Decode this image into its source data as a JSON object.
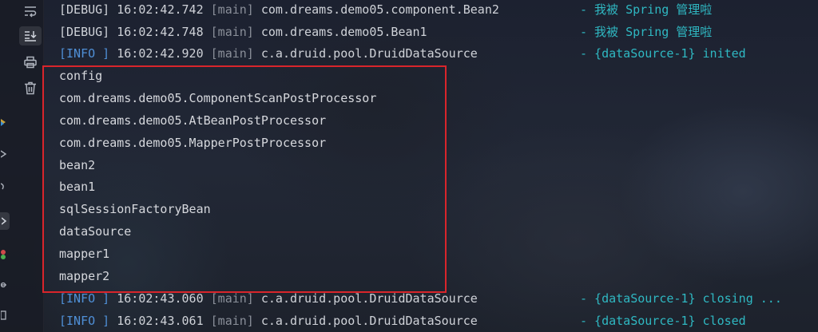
{
  "toolbar": {
    "icons": [
      "soft-wrap-icon",
      "scroll-to-end-icon",
      "print-icon",
      "trash-icon"
    ]
  },
  "log_top": [
    {
      "level": "[DEBUG]",
      "time": "16:02:42.742",
      "thread": "[main]",
      "logger": "com.dreams.demo05.component.Bean2",
      "message": "- 我被 Spring 管理啦"
    },
    {
      "level": "[DEBUG]",
      "time": "16:02:42.748",
      "thread": "[main]",
      "logger": "com.dreams.demo05.Bean1",
      "message": "- 我被 Spring 管理啦"
    },
    {
      "level": "[INFO ]",
      "time": "16:02:42.920",
      "thread": "[main]",
      "logger": "c.a.druid.pool.DruidDataSource",
      "message": "- {dataSource-1} inited"
    }
  ],
  "output_lines": [
    "config",
    "com.dreams.demo05.ComponentScanPostProcessor",
    "com.dreams.demo05.AtBeanPostProcessor",
    "com.dreams.demo05.MapperPostProcessor",
    "bean2",
    "bean1",
    "sqlSessionFactoryBean",
    "dataSource",
    "mapper1",
    "mapper2"
  ],
  "log_bottom": [
    {
      "level": "[INFO ]",
      "time": "16:02:43.060",
      "thread": "[main]",
      "logger": "c.a.druid.pool.DruidDataSource",
      "message": "- {dataSource-1} closing ..."
    },
    {
      "level": "[INFO ]",
      "time": "16:02:43.061",
      "thread": "[main]",
      "logger": "c.a.druid.pool.DruidDataSource",
      "message": "- {dataSource-1} closed"
    }
  ],
  "colors": {
    "debug": "#cfd2d8",
    "info": "#4f8fd6",
    "message": "#2fb8c2",
    "highlight_border": "#d9252b"
  }
}
